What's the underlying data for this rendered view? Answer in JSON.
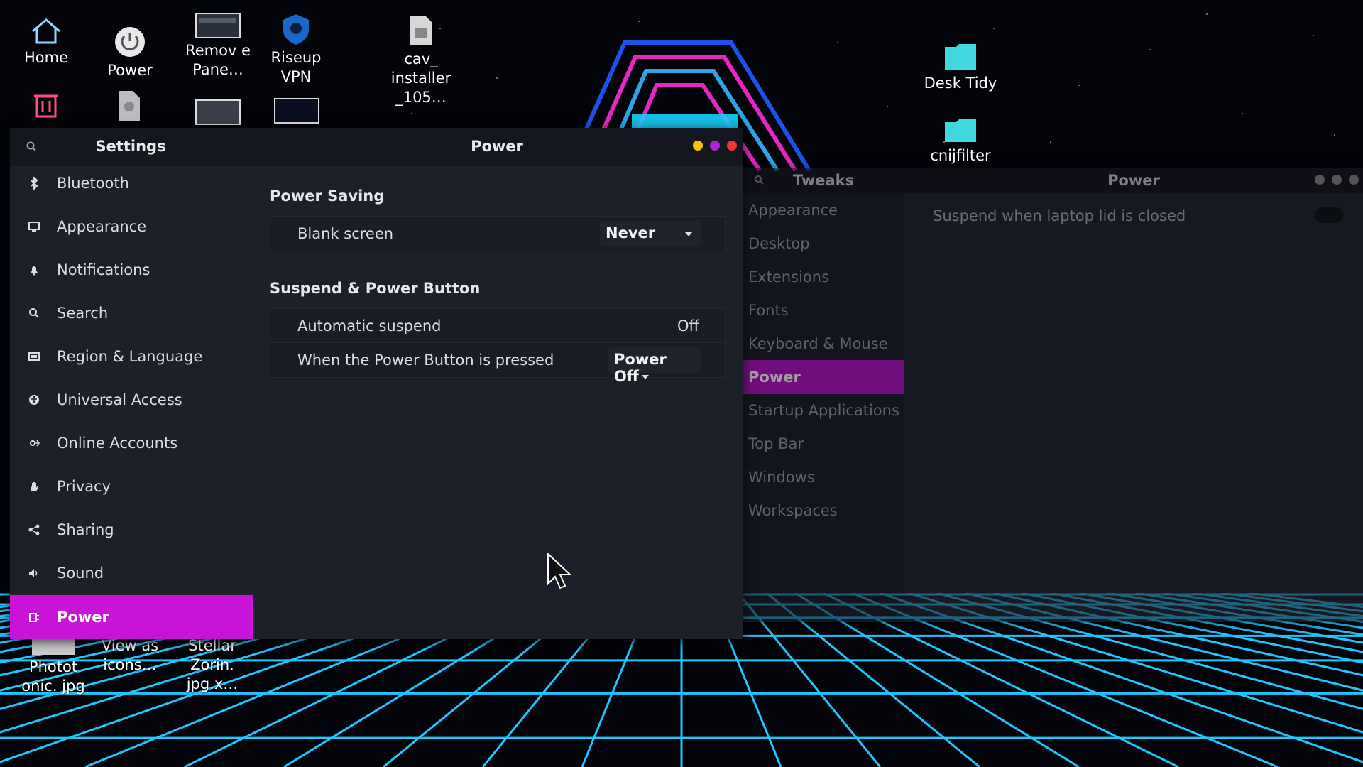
{
  "desktop": {
    "icons_top": [
      {
        "name": "home",
        "label": "Home"
      },
      {
        "name": "power",
        "label": "Power"
      },
      {
        "name": "remove-panel",
        "label": "Remov e Pane…"
      },
      {
        "name": "riseup-vpn",
        "label": "Riseup VPN"
      },
      {
        "name": "cav-installer",
        "label": "cav_ installer _105…"
      },
      {
        "name": "desk-tidy",
        "label": "Desk Tidy"
      },
      {
        "name": "cnijfilter",
        "label": "cnijfilter"
      }
    ],
    "icons_bottom": [
      {
        "name": "photo-file",
        "label": "Photot onic. jpg"
      },
      {
        "name": "view-as-icons",
        "label": "View as icons…"
      },
      {
        "name": "stellar-zorin",
        "label": "Stellar Zorin. jpg.x…"
      }
    ]
  },
  "settings": {
    "search_icon": "search-icon",
    "sidebar_title": "Settings",
    "page_title": "Power",
    "window_dot_colors": [
      "#f5c400",
      "#b020d8",
      "#f03535"
    ],
    "sidebar": [
      {
        "label": "Bluetooth",
        "icon": "bluetooth-icon"
      },
      {
        "label": "Appearance",
        "icon": "appearance-icon"
      },
      {
        "label": "Notifications",
        "icon": "bell-icon"
      },
      {
        "label": "Search",
        "icon": "search-icon"
      },
      {
        "label": "Region & Language",
        "icon": "flag-icon"
      },
      {
        "label": "Universal Access",
        "icon": "accessibility-icon"
      },
      {
        "label": "Online Accounts",
        "icon": "accounts-icon"
      },
      {
        "label": "Privacy",
        "icon": "hand-icon"
      },
      {
        "label": "Sharing",
        "icon": "share-icon"
      },
      {
        "label": "Sound",
        "icon": "speaker-icon"
      },
      {
        "label": "Power",
        "icon": "power-plug-icon",
        "active": true
      }
    ],
    "power_saving": {
      "title": "Power Saving",
      "blank_screen_label": "Blank screen",
      "blank_screen_value": "Never"
    },
    "suspend": {
      "title": "Suspend & Power Button",
      "auto_suspend_label": "Automatic suspend",
      "auto_suspend_value": "Off",
      "power_button_label": "When the Power Button is pressed",
      "power_button_value": "Power Off"
    },
    "accent": "#c913d9"
  },
  "tweaks": {
    "title": "Tweaks",
    "page_title": "Power",
    "items": [
      {
        "label": "Appearance"
      },
      {
        "label": "Desktop"
      },
      {
        "label": "Extensions"
      },
      {
        "label": "Fonts"
      },
      {
        "label": "Keyboard & Mouse"
      },
      {
        "label": "Power",
        "active": true
      },
      {
        "label": "Startup Applications"
      },
      {
        "label": "Top Bar"
      },
      {
        "label": "Windows"
      },
      {
        "label": "Workspaces"
      }
    ],
    "suspend_lid_label": "Suspend when laptop lid is closed",
    "suspend_lid_on": false
  }
}
